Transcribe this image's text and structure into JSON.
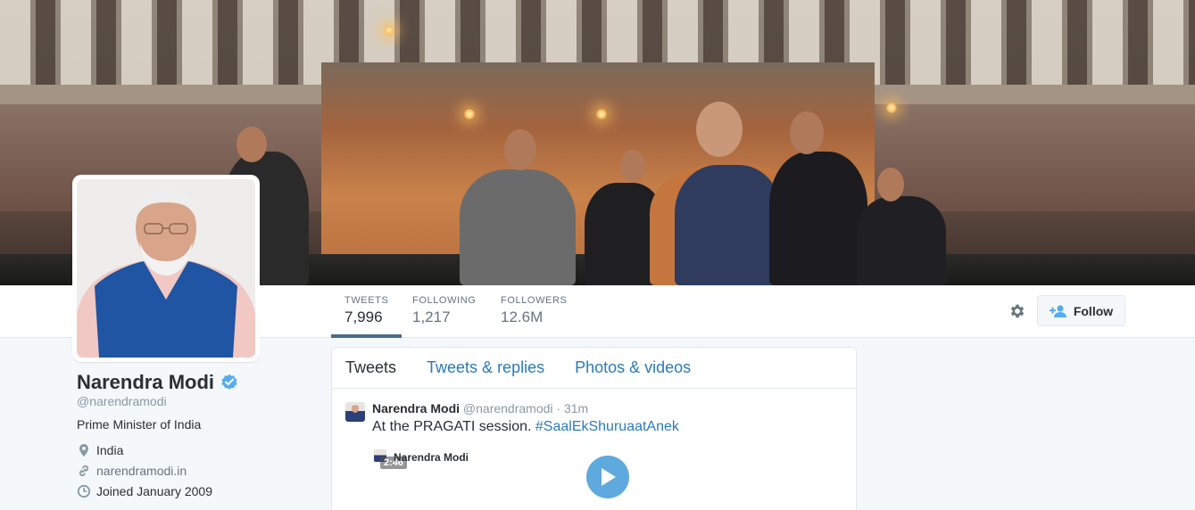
{
  "profile": {
    "name": "Narendra Modi",
    "handle": "@narendramodi",
    "bio": "Prime Minister of India",
    "location": "India",
    "website": "narendramodi.in",
    "joined": "Joined January 2009"
  },
  "stats": [
    {
      "label": "TWEETS",
      "value": "7,996"
    },
    {
      "label": "FOLLOWING",
      "value": "1,217"
    },
    {
      "label": "FOLLOWERS",
      "value": "12.6M"
    }
  ],
  "actions": {
    "follow_label": "Follow"
  },
  "tabs": [
    {
      "label": "Tweets"
    },
    {
      "label": "Tweets & replies"
    },
    {
      "label": "Photos & videos"
    }
  ],
  "tweet": {
    "author": "Narendra Modi",
    "handle": "@narendramodi",
    "separator": "·",
    "time": "31m",
    "text": "At the PRAGATI session.",
    "hashtag": "#SaalEkShuruaatAnek",
    "media_title": "Narendra Modi",
    "media_duration": "2:46"
  },
  "colors": {
    "link": "#2b7bb9",
    "verified": "#55acee",
    "play_button": "#5ea9dd",
    "active_tab_underline": "#4a6b8a"
  },
  "icons": [
    "verified-badge-icon",
    "location-pin-icon",
    "link-icon",
    "calendar-clock-icon",
    "gear-icon",
    "add-user-icon",
    "play-icon"
  ]
}
